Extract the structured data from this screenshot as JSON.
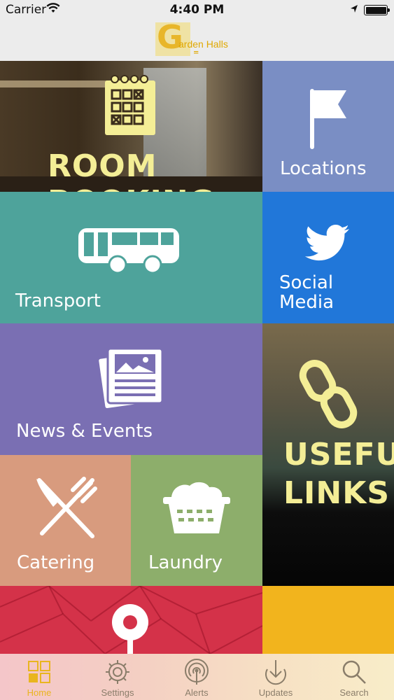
{
  "status_bar": {
    "carrier": "Carrier",
    "time": "4:40 PM"
  },
  "header": {
    "logo_initial": "G",
    "logo_text": "arden Halls",
    "logo_mark": "="
  },
  "tiles": {
    "room_booking": "ROOM BOOKING",
    "locations": "Locations",
    "transport": "Transport",
    "social_media_line1": "Social",
    "social_media_line2": "Media",
    "news_events": "News & Events",
    "useful_links_line1": "USEFUL",
    "useful_links_line2": "LINKS",
    "catering": "Catering",
    "laundry": "Laundry"
  },
  "tab_bar": [
    {
      "label": "Home",
      "icon": "home-grid-icon",
      "active": true
    },
    {
      "label": "Settings",
      "icon": "gear-icon",
      "active": false
    },
    {
      "label": "Alerts",
      "icon": "broadcast-icon",
      "active": false
    },
    {
      "label": "Updates",
      "icon": "download-icon",
      "active": false
    },
    {
      "label": "Search",
      "icon": "search-icon",
      "active": false
    }
  ],
  "colors": {
    "accent": "#e9b51f",
    "locations": "#7a8ec4",
    "transport": "#4ea39b",
    "social": "#2177d9",
    "news": "#7a6fb3",
    "catering": "#d89b7e",
    "laundry": "#8dae6b",
    "red_tile": "#d43249",
    "yellow_tile": "#f2b41d"
  }
}
